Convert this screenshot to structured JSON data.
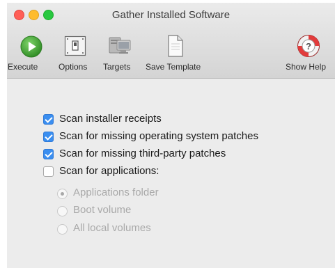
{
  "window": {
    "title": "Gather Installed Software"
  },
  "toolbar": {
    "items": [
      {
        "label": "Execute",
        "icon": "play-icon"
      },
      {
        "label": "Options",
        "icon": "switch-icon"
      },
      {
        "label": "Targets",
        "icon": "computers-icon"
      },
      {
        "label": "Save Template",
        "icon": "document-icon"
      },
      {
        "label": "Show Help",
        "icon": "lifebuoy-help-icon"
      }
    ]
  },
  "options": {
    "checkboxes": [
      {
        "label": "Scan installer receipts",
        "checked": true
      },
      {
        "label": "Scan for missing operating system patches",
        "checked": true
      },
      {
        "label": "Scan for missing third-party patches",
        "checked": true
      },
      {
        "label": "Scan for applications:",
        "checked": false
      }
    ],
    "app_scope": [
      {
        "label": "Applications folder",
        "selected": true,
        "enabled": false
      },
      {
        "label": "Boot volume",
        "selected": false,
        "enabled": false
      },
      {
        "label": "All local volumes",
        "selected": false,
        "enabled": false
      }
    ]
  },
  "colors": {
    "accent": "#3a8ef0",
    "execute": "#3fa535",
    "help": "#e23b3b"
  }
}
